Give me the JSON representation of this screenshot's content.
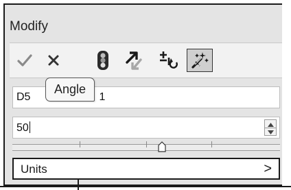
{
  "panel": {
    "title": "Modify"
  },
  "toolbar": {
    "buttons": [
      {
        "name": "check-icon"
      },
      {
        "name": "close-icon"
      },
      {
        "name": "traffic-light-icon"
      },
      {
        "name": "move-arrows-icon"
      },
      {
        "name": "plus-minus-rotate-icon"
      },
      {
        "name": "magic-wand-icon",
        "active": true
      }
    ]
  },
  "fields": {
    "name_value_visible": "D5",
    "name_value_tail": "1",
    "angle_value": "50"
  },
  "tooltip": {
    "text": "Angle"
  },
  "slider": {
    "ticks": 5,
    "position": 0.56
  },
  "units": {
    "label": "Units",
    "arrow": ">"
  },
  "colors": {
    "panel_bg": "#e4e4e4",
    "field_bg": "#ffffff",
    "active_button_bg": "#cfcfcf"
  }
}
